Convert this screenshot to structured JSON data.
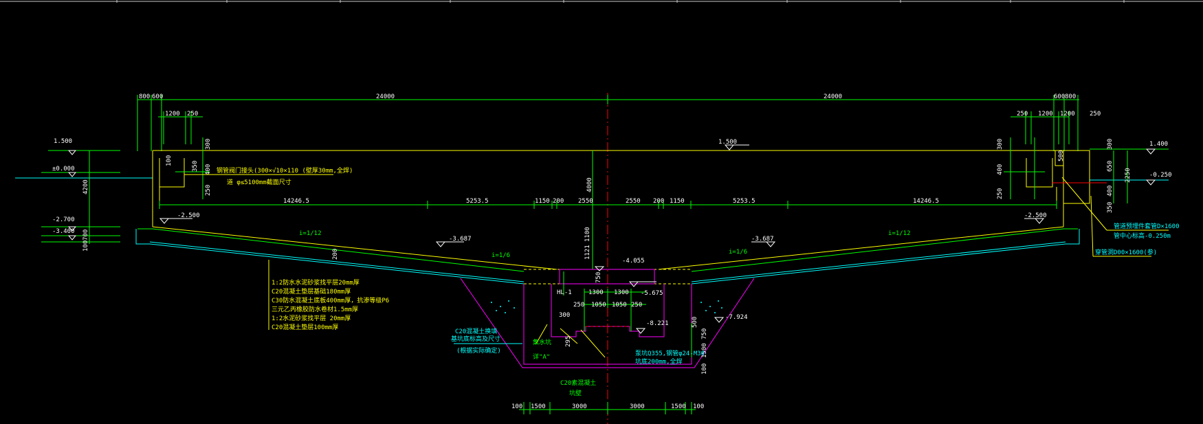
{
  "colors": {
    "background": "#000000",
    "dimension": "#00ff00",
    "outline": "#ffff00",
    "boundary": "#00ffff",
    "pit": "#ff00ff",
    "centerline": "#ff0000",
    "text": "#ffffff"
  },
  "top_dims": [
    "800",
    "600",
    "24000",
    "24000",
    "600",
    "800"
  ],
  "top_left_sub": [
    "1200",
    "250"
  ],
  "top_right_sub": [
    "250",
    "1200",
    "1200",
    "250"
  ],
  "left_levels": [
    "1.500",
    "±0.000",
    "-2.700",
    "-3.400"
  ],
  "left_vert_dims": [
    "4200",
    "700",
    "100"
  ],
  "left_wall_dims": [
    "300",
    "100",
    "400",
    "250",
    "350"
  ],
  "wall_note_1": "钢管阀门接头(300×√10×110 (壁厚30mm,全焊)",
  "wall_note_2": "道 φ≤5100mm截面尺寸",
  "center_top_level": "1.500",
  "center_height": "4000",
  "horizontal_dims": [
    "14246.5",
    "5253.5",
    "1150",
    "200",
    "2550",
    "2550",
    "200",
    "1150",
    "5253.5",
    "14246.5"
  ],
  "floor_levels": [
    "-2.500",
    "-3.687",
    "-3.687",
    "-2.500"
  ],
  "slopes": [
    "i=1/12",
    "i=1/6",
    "i=1/6",
    "i=1/12"
  ],
  "floor_thickness": "200",
  "center_levels": [
    "-4.055",
    "-5.675",
    "-8.221",
    "-7.924"
  ],
  "pit_vert_dims": [
    "1100",
    "1121",
    "750",
    "300",
    "295",
    "500",
    "750",
    "1500",
    "100"
  ],
  "pit_horiz_dims": [
    "1300",
    "1300",
    "250",
    "1050",
    "1050",
    "250"
  ],
  "pit_labels": {
    "hl": "HL-1",
    "sump": "集水坑",
    "detail": "详\"A\"",
    "pipe_1": "泵坑Q355,钢管φ24-M30",
    "pipe_2": "坑底200mm,全焊",
    "concrete_1": "C20素混凝土",
    "concrete_2": "坑壁"
  },
  "layer_notes": [
    "1:2防水水泥砂浆找平层20mm厚",
    "C20混凝土垫层基础180mm厚",
    "C30防水混凝土底板400mm厚，抗渗等级P6",
    "三元乙丙橡胶防水卷材1.5mm厚",
    "1:2水泥砂浆找平层 20mm厚",
    "C20混凝土垫层100mm厚"
  ],
  "excavation_note": [
    "C20混凝土换填",
    "基坑底标高及尺寸",
    "(根据实际确定)"
  ],
  "right_levels": [
    "1.400",
    "-0.250"
  ],
  "right_dims": [
    "300",
    "400",
    "250",
    "500",
    "300",
    "650",
    "400",
    "350",
    "2250"
  ],
  "right_notes": [
    "管道预埋件套管D×1600",
    "管中心标高-0.250m",
    "穿管洞D00×1600(参)"
  ],
  "bottom_dims": [
    "100",
    "1500",
    "3000",
    "3000",
    "1500",
    "100"
  ]
}
